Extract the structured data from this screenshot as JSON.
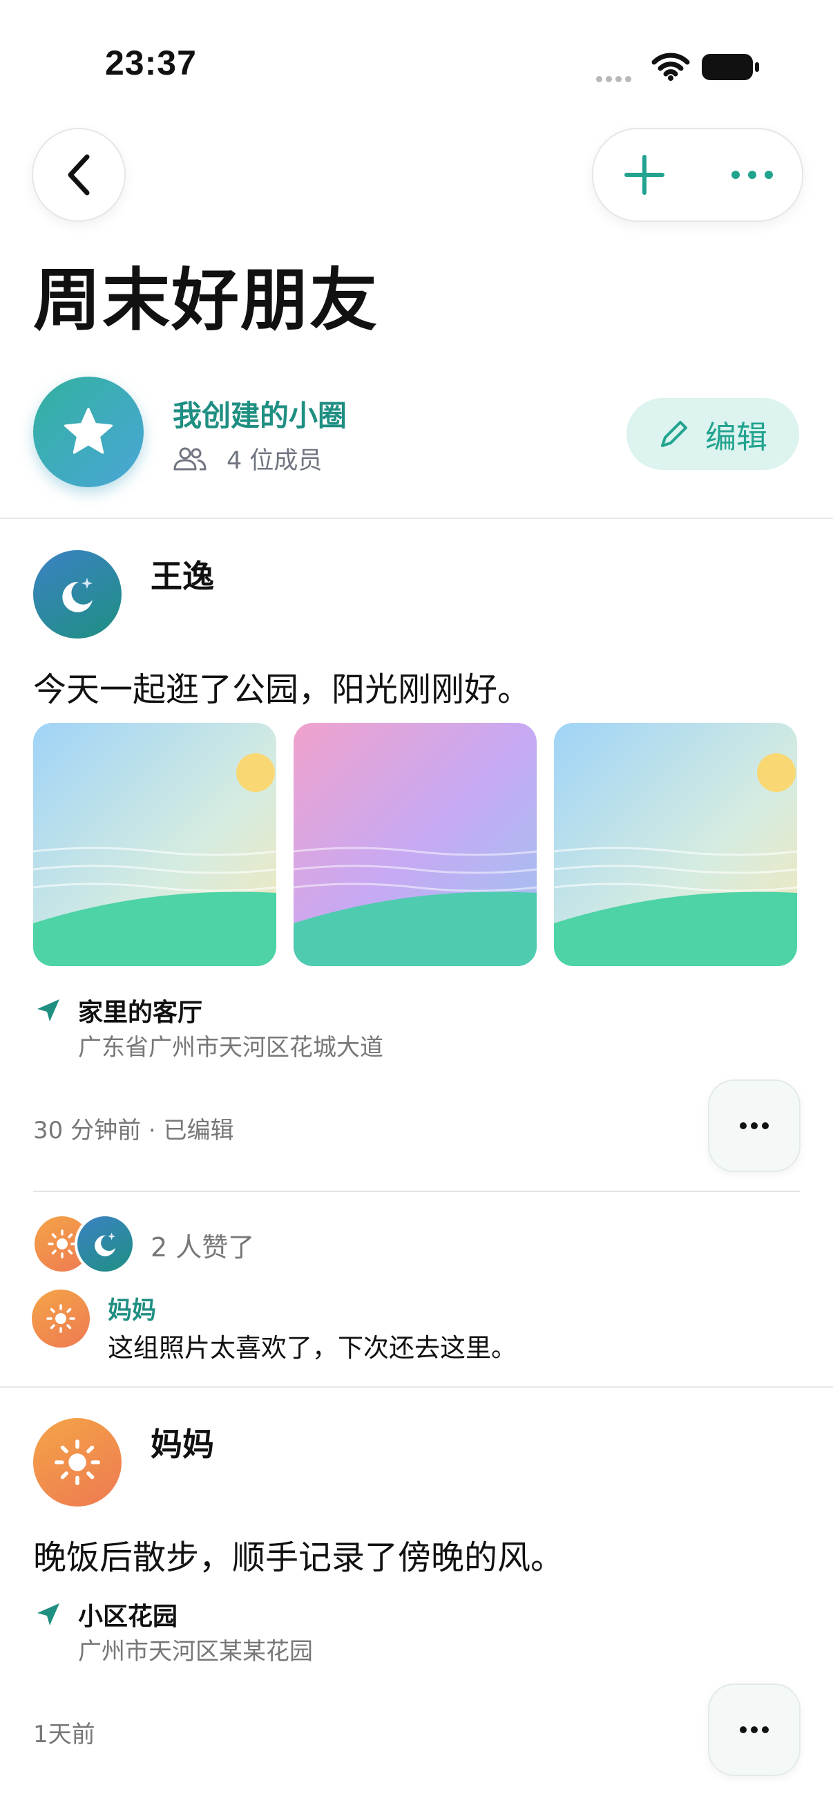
{
  "status_bar": {
    "time": "23:37"
  },
  "page": {
    "title": "周末好朋友"
  },
  "circle": {
    "label": "我创建的小圈",
    "members": "4 位成员",
    "edit_label": "编辑"
  },
  "colors": {
    "accent": "#1f8f82",
    "accent_light": "#dcf3ef",
    "text_secondary": "#777777"
  },
  "posts": [
    {
      "author": "王逸",
      "avatar_icon": "moon-icon",
      "text": "今天一起逛了公园，阳光刚刚好。",
      "location_name": "家里的客厅",
      "location_address": "广东省广州市天河区花城大道",
      "meta": "30 分钟前 · 已编辑",
      "likes": "2 人赞了",
      "comments": [
        {
          "author": "妈妈",
          "text": "这组照片太喜欢了，下次还去这里。"
        }
      ]
    },
    {
      "author": "妈妈",
      "avatar_icon": "sun-icon",
      "text": "晚饭后散步，顺手记录了傍晚的风。",
      "location_name": "小区花园",
      "location_address": "广州市天河区某某花园",
      "meta": "1天前"
    }
  ]
}
